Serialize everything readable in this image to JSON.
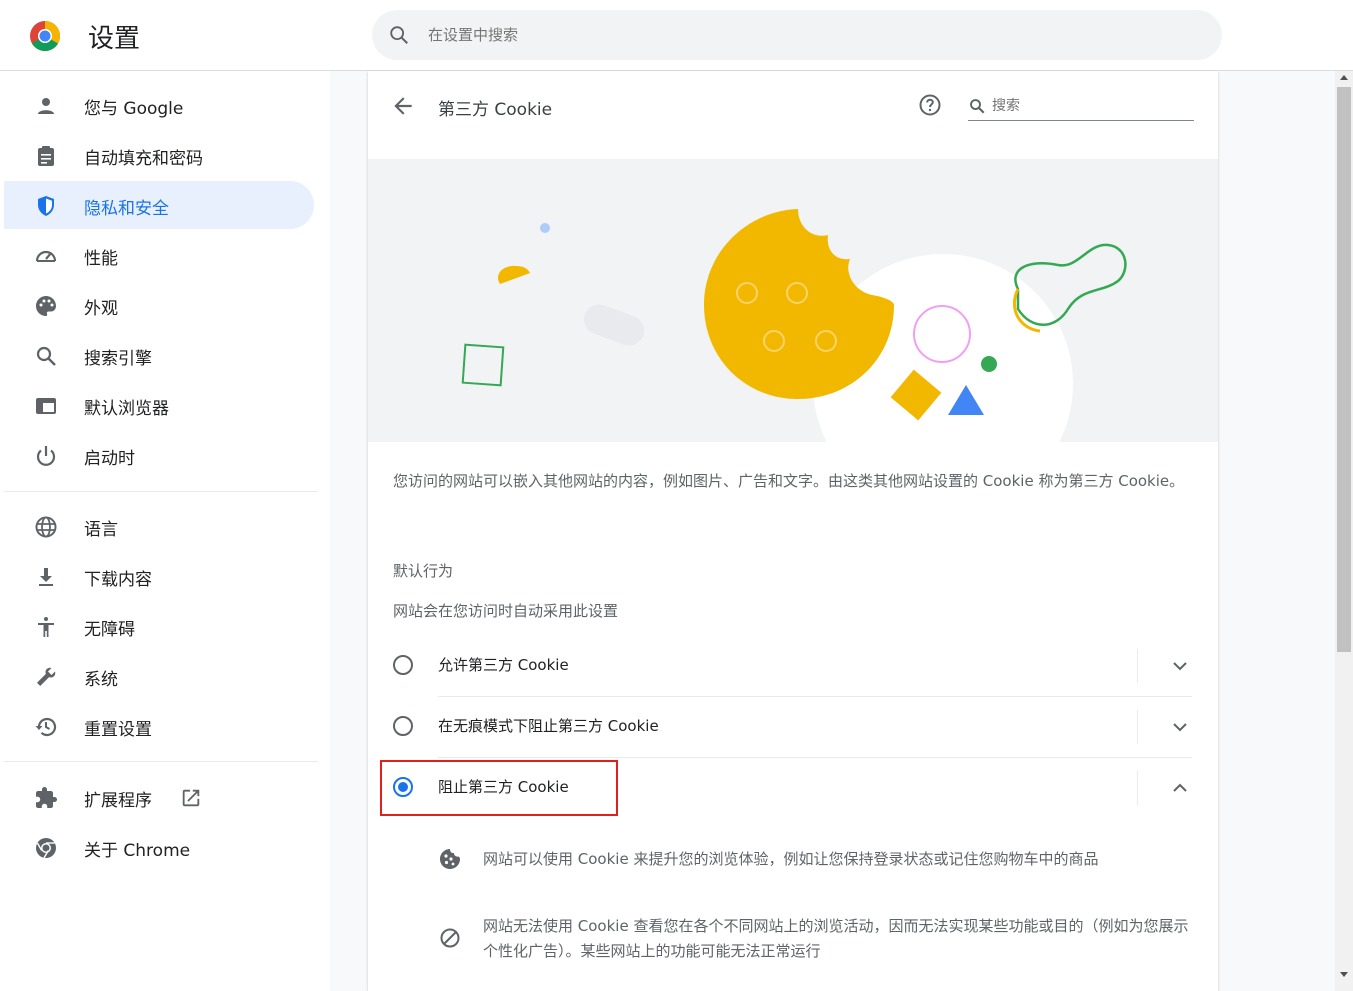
{
  "header": {
    "title": "设置",
    "search_placeholder": "在设置中搜索"
  },
  "sidebar": {
    "items": [
      {
        "label": "您与 Google",
        "icon": "person-icon"
      },
      {
        "label": "自动填充和密码",
        "icon": "clipboard-icon"
      },
      {
        "label": "隐私和安全",
        "icon": "shield-icon",
        "active": true
      },
      {
        "label": "性能",
        "icon": "speedometer-icon"
      },
      {
        "label": "外观",
        "icon": "palette-icon"
      },
      {
        "label": "搜索引擎",
        "icon": "search-icon"
      },
      {
        "label": "默认浏览器",
        "icon": "browser-icon"
      },
      {
        "label": "启动时",
        "icon": "power-icon"
      },
      {
        "label": "语言",
        "icon": "globe-icon"
      },
      {
        "label": "下载内容",
        "icon": "download-icon"
      },
      {
        "label": "无障碍",
        "icon": "accessibility-icon"
      },
      {
        "label": "系统",
        "icon": "wrench-icon"
      },
      {
        "label": "重置设置",
        "icon": "restore-icon"
      },
      {
        "label": "扩展程序",
        "icon": "puzzle-icon"
      },
      {
        "label": "关于 Chrome",
        "icon": "chrome-icon"
      }
    ]
  },
  "subpage": {
    "title": "第三方 Cookie",
    "search_placeholder": "搜索",
    "description": "您访问的网站可以嵌入其他网站的内容，例如图片、广告和文字。由这类其他网站设置的 Cookie 称为第三方 Cookie。",
    "default_behavior_label": "默认行为",
    "default_behavior_sub": "网站会在您访问时自动采用此设置",
    "options": [
      {
        "label": "允许第三方 Cookie",
        "checked": false,
        "expanded": false
      },
      {
        "label": "在无痕模式下阻止第三方 Cookie",
        "checked": false,
        "expanded": false
      },
      {
        "label": "阻止第三方 Cookie",
        "checked": true,
        "expanded": true
      }
    ],
    "details": [
      {
        "icon": "cookie-icon",
        "text": "网站可以使用 Cookie 来提升您的浏览体验，例如让您保持登录状态或记住您购物车中的商品"
      },
      {
        "icon": "block-icon",
        "text": "网站无法使用 Cookie 查看您在各个不同网站上的浏览活动，因而无法实现某些功能或目的（例如为您展示个性化广告）。某些网站上的功能可能无法正常运行"
      }
    ]
  },
  "colors": {
    "accent": "#1a73e8",
    "highlight": "#e0201c",
    "cookie": "#f2b800"
  }
}
